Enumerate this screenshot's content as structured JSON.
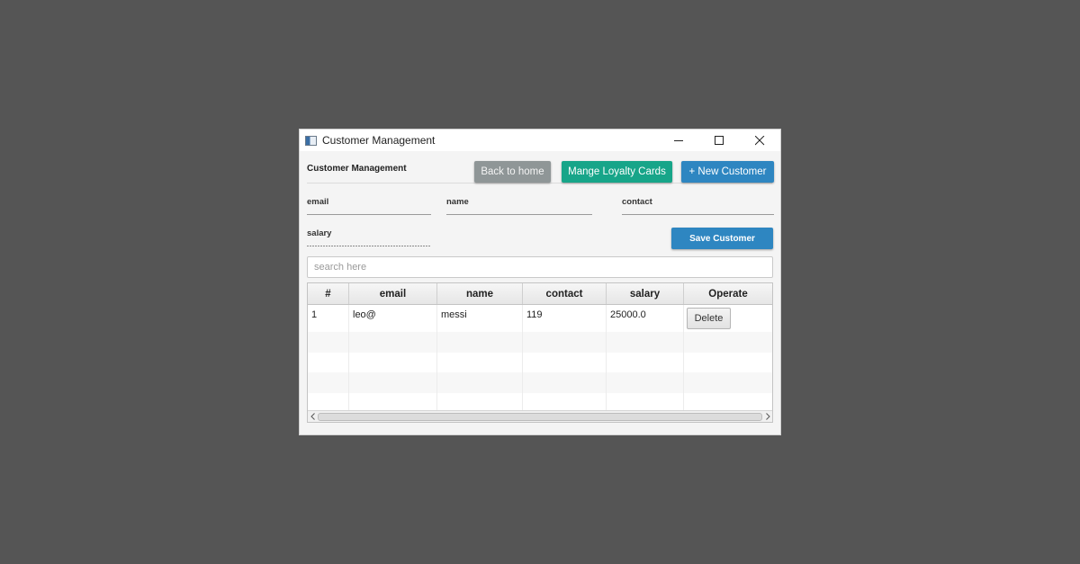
{
  "window": {
    "title": "Customer Management"
  },
  "header": {
    "label": "Customer Management",
    "back_button": "Back to home",
    "loyalty_button": "Mange Loyalty Cards",
    "new_customer_button": "+ New Customer"
  },
  "form": {
    "email_label": "email",
    "name_label": "name",
    "contact_label": "contact",
    "salary_label": "salary",
    "save_button": "Save Customer"
  },
  "search": {
    "placeholder": "search here"
  },
  "table": {
    "columns": [
      "#",
      "email",
      "name",
      "contact",
      "salary",
      "Operate"
    ],
    "rows": [
      {
        "index": "1",
        "email": "leo@",
        "name": "messi",
        "contact": "119",
        "salary": "25000.0",
        "action": "Delete"
      }
    ]
  },
  "colors": {
    "background": "#555555",
    "back_button": "#8f9697",
    "loyalty_button": "#17a589",
    "primary_button": "#2e86c1"
  },
  "icons": {
    "app": "window-app-icon",
    "minimize": "minimize-icon",
    "maximize": "maximize-icon",
    "close": "close-icon",
    "scroll_left": "chevron-left-icon",
    "scroll_right": "chevron-right-icon"
  }
}
